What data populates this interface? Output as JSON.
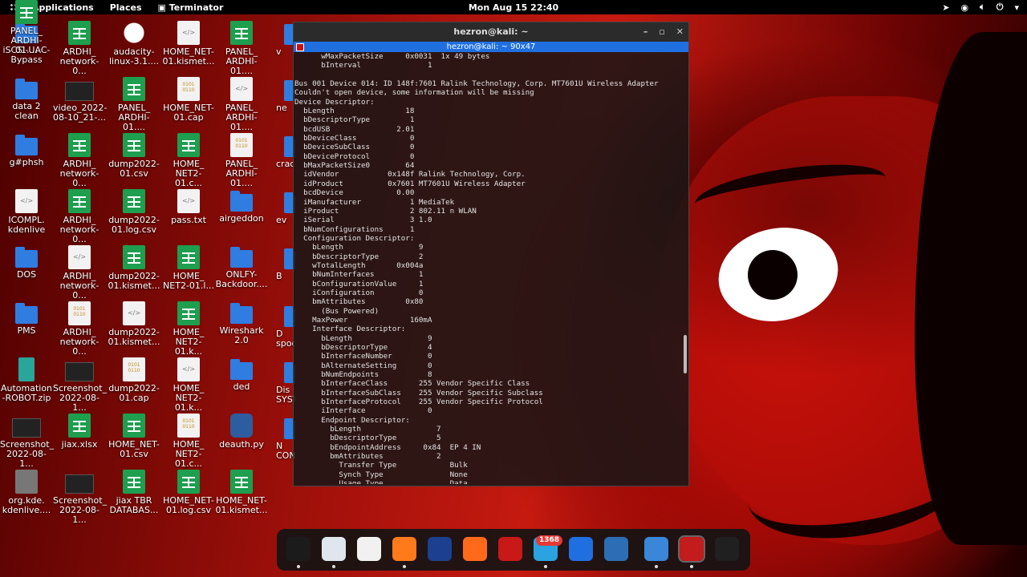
{
  "topbar": {
    "apps_label": "Applications",
    "places_label": "Places",
    "terminal_task": "Terminator",
    "clock": "Mon Aug 15  22:40"
  },
  "desktop_icons": [
    {
      "label": "iSCSI-UAC-\nBypass",
      "kind": "folder"
    },
    {
      "label": "ARDHI_\nnetwork-0...",
      "kind": "sheet"
    },
    {
      "label": "audacity-\nlinux-3.1....",
      "kind": "gear"
    },
    {
      "label": "HOME_NET-\n01.kismet...",
      "kind": "doc"
    },
    {
      "label": "PANEL_\nARDHI-01....",
      "kind": "sheet"
    },
    {
      "label": "data 2\nclean",
      "kind": "folder"
    },
    {
      "label": "video_2022-\n08-10_21-...",
      "kind": "shot"
    },
    {
      "label": "PANEL_\nARDHI-01....",
      "kind": "sheet"
    },
    {
      "label": "HOME_NET-\n01.cap",
      "kind": "bin"
    },
    {
      "label": "PANEL_\nARDHI-01....",
      "kind": "doc"
    },
    {
      "label": "g#phsh",
      "kind": "folder"
    },
    {
      "label": "ARDHI_\nnetwork-0...",
      "kind": "sheet"
    },
    {
      "label": "dump2022-\n01.csv",
      "kind": "sheet"
    },
    {
      "label": "HOME_\nNET2-01.c...",
      "kind": "sheet"
    },
    {
      "label": "PANEL_\nARDHI-01....",
      "kind": "bin"
    },
    {
      "label": "ICOMPL.\nkdenlive",
      "kind": "doc"
    },
    {
      "label": "ARDHI_\nnetwork-0...",
      "kind": "sheet"
    },
    {
      "label": "dump2022-\n01.log.csv",
      "kind": "sheet"
    },
    {
      "label": "pass.txt",
      "kind": "doc"
    },
    {
      "label": "airgeddon",
      "kind": "folder"
    },
    {
      "label": "DOS",
      "kind": "folder"
    },
    {
      "label": "ARDHI_\nnetwork-0...",
      "kind": "doc"
    },
    {
      "label": "dump2022-\n01.kismet...",
      "kind": "sheet"
    },
    {
      "label": "HOME_\nNET2-01.l...",
      "kind": "sheet"
    },
    {
      "label": "ONLFY-\nBackdoor....",
      "kind": "folder"
    },
    {
      "label": "PMS",
      "kind": "folder"
    },
    {
      "label": "ARDHI_\nnetwork-0...",
      "kind": "bin"
    },
    {
      "label": "dump2022-\n01.kismet...",
      "kind": "doc"
    },
    {
      "label": "HOME_\nNET2-01.k...",
      "kind": "sheet"
    },
    {
      "label": "Wireshark\n2.0",
      "kind": "folder"
    },
    {
      "label": "Automation\n-ROBOT.zip",
      "kind": "zip"
    },
    {
      "label": "Screenshot_\n2022-08-1...",
      "kind": "shot"
    },
    {
      "label": "dump2022-\n01.cap",
      "kind": "bin"
    },
    {
      "label": "HOME_\nNET2-01.k...",
      "kind": "doc"
    },
    {
      "label": "ded",
      "kind": "folder"
    },
    {
      "label": "Screenshot_\n2022-08-1...",
      "kind": "shot"
    },
    {
      "label": "jiax.xlsx",
      "kind": "sheet"
    },
    {
      "label": "HOME_NET-\n01.csv",
      "kind": "sheet"
    },
    {
      "label": "HOME_\nNET2-01.c...",
      "kind": "bin"
    },
    {
      "label": "deauth.py",
      "kind": "py"
    },
    {
      "label": "org.kde.\nkdenlive....",
      "kind": "kde"
    },
    {
      "label": "Screenshot_\n2022-08-1...",
      "kind": "shot"
    },
    {
      "label": "jiax TBR\nDATABAS...",
      "kind": "sheet"
    },
    {
      "label": "HOME_NET-\n01.log.csv",
      "kind": "sheet"
    },
    {
      "label": "HOME_NET-\n01.kismet...",
      "kind": "sheet"
    },
    {
      "label": "PANEL_\nARDHI-01....",
      "kind": "sheet"
    }
  ],
  "partial_icons": [
    {
      "label": "v"
    },
    {
      "label": "ne"
    },
    {
      "label": "crac"
    },
    {
      "label": "ev"
    },
    {
      "label": "B"
    },
    {
      "label": "D\nspoo"
    },
    {
      "label": "Dis\nSYST"
    },
    {
      "label": "N\nCONT"
    }
  ],
  "terminal": {
    "window_title": "hezron@kali: ~",
    "tab_title": "hezron@kali: ~ 90x47",
    "output": "      wMaxPacketSize     0x0031  1x 49 bytes\n      bInterval               1\n\nBus 001 Device 014: ID 148f:7601 Ralink Technology, Corp. MT7601U Wireless Adapter\nCouldn't open device, some information will be missing\nDevice Descriptor:\n  bLength                18\n  bDescriptorType         1\n  bcdUSB               2.01\n  bDeviceClass            0\n  bDeviceSubClass         0\n  bDeviceProtocol         0\n  bMaxPacketSize0        64\n  idVendor           0x148f Ralink Technology, Corp.\n  idProduct          0x7601 MT7601U Wireless Adapter\n  bcdDevice            0.00\n  iManufacturer           1 MediaTek\n  iProduct                2 802.11 n WLAN\n  iSerial                 3 1.0\n  bNumConfigurations      1\n  Configuration Descriptor:\n    bLength                 9\n    bDescriptorType         2\n    wTotalLength       0x004a\n    bNumInterfaces          1\n    bConfigurationValue     1\n    iConfiguration          0\n    bmAttributes         0x80\n      (Bus Powered)\n    MaxPower              160mA\n    Interface Descriptor:\n      bLength                 9\n      bDescriptorType         4\n      bInterfaceNumber        0\n      bAlternateSetting       0\n      bNumEndpoints           8\n      bInterfaceClass       255 Vendor Specific Class\n      bInterfaceSubClass    255 Vendor Specific Subclass\n      bInterfaceProtocol    255 Vendor Specific Protocol\n      iInterface              0\n      Endpoint Descriptor:\n        bLength                 7\n        bDescriptorType         5\n        bEndpointAddress     0x84  EP 4 IN\n        bmAttributes            2\n          Transfer Type            Bulk\n          Synch Type               None\n          Usage Type               Data"
  },
  "dock": {
    "telegram_badge": "1368",
    "apps": [
      {
        "name": "terminal-app-icon",
        "color": "#1b1b1b"
      },
      {
        "name": "files-app-icon",
        "color": "#dfe6ee"
      },
      {
        "name": "text-editor-app-icon",
        "color": "#f1f1f1"
      },
      {
        "name": "firefox-app-icon",
        "color": "#ff7a1a"
      },
      {
        "name": "metasploit-app-icon",
        "color": "#1d3f8f"
      },
      {
        "name": "burpsuite-app-icon",
        "color": "#ff6a1a"
      },
      {
        "name": "cherrytree-app-icon",
        "color": "#c81818"
      },
      {
        "name": "telegram-app-icon",
        "color": "#2aa3e0"
      },
      {
        "name": "teamviewer-app-icon",
        "color": "#1f6fe0"
      },
      {
        "name": "system-monitor-app-icon",
        "color": "#2d6db5"
      },
      {
        "name": "settings-app-icon",
        "color": "#3a86d8"
      },
      {
        "name": "terminator-app-icon",
        "color": "#c21c1c"
      },
      {
        "name": "show-apps-icon",
        "color": "#202020"
      }
    ]
  }
}
